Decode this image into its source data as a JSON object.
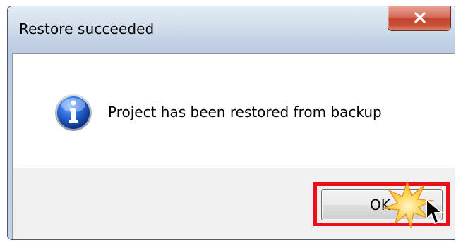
{
  "window": {
    "title": "Restore succeeded"
  },
  "dialog": {
    "message": "Project has been restored from backup",
    "icon": "info-icon",
    "ok_label": "OK"
  },
  "colors": {
    "highlight_border": "#e8101b",
    "close_button": "#c8513a",
    "info_icon": "#1f5bc8"
  }
}
